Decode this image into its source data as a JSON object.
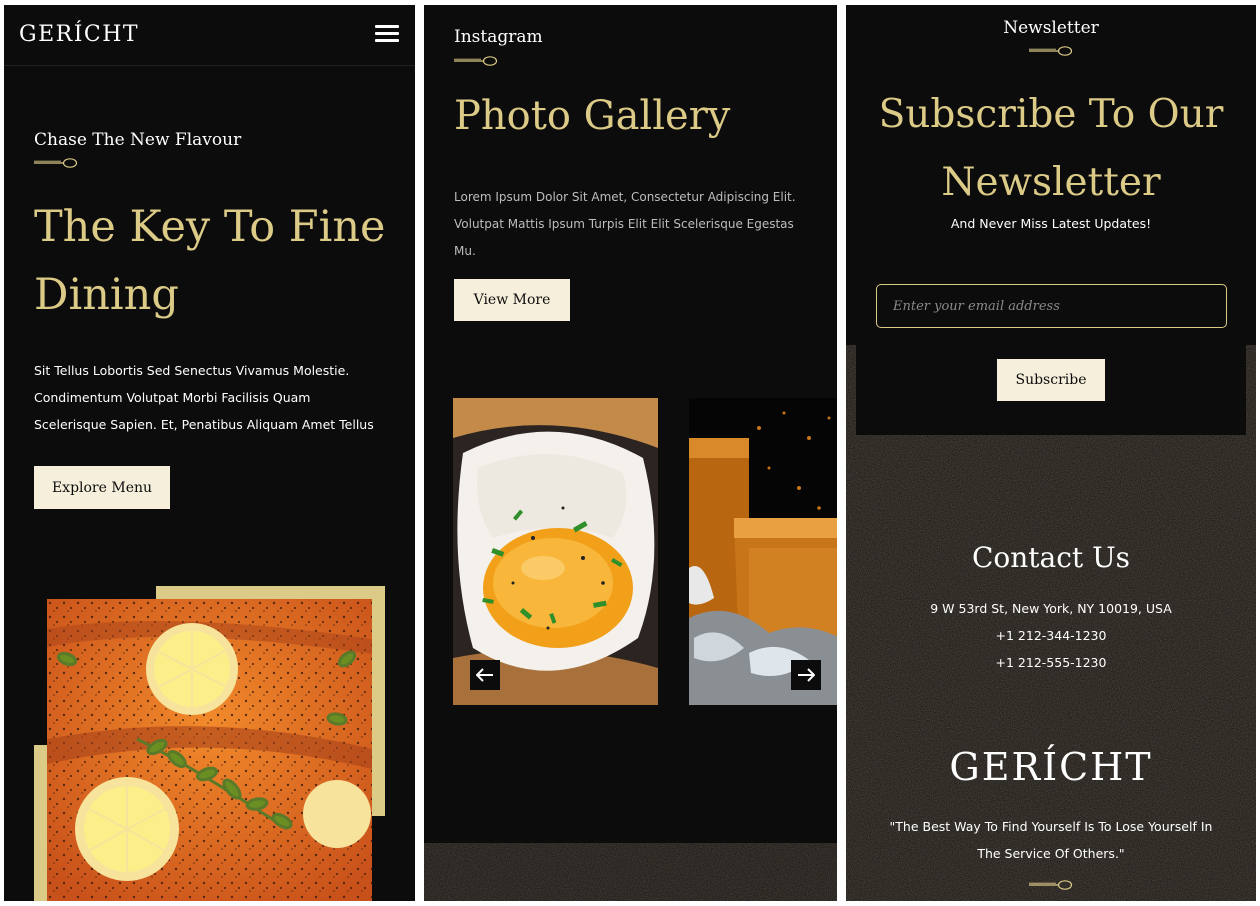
{
  "hero": {
    "logo": "GERÍCHT",
    "subtitle": "Chase The New Flavour",
    "title": "The Key To Fine Dining",
    "description": "Sit Tellus Lobortis Sed Senectus Vivamus Molestie. Condimentum Volutpat Morbi Facilisis Quam Scelerisque Sapien. Et, Penatibus Aliquam Amet Tellus",
    "button": "Explore Menu",
    "image_icon": "salmon-dish-image"
  },
  "gallery": {
    "label": "Instagram",
    "title": "Photo Gallery",
    "description": "Lorem Ipsum Dolor Sit Amet, Consectetur Adipiscing Elit. Volutpat Mattis Ipsum Turpis Elit Elit Scelerisque Egestas Mu.",
    "button": "View More",
    "images": [
      "fried-egg-toast-image",
      "whiskey-glass-image"
    ],
    "arrow_left_icon": "arrow-left-icon",
    "arrow_right_icon": "arrow-right-icon"
  },
  "newsletter": {
    "label": "Newsletter",
    "title": "Subscribe To Our Newsletter",
    "subtitle": "And Never Miss Latest Updates!",
    "placeholder": "Enter your email address",
    "button": "Subscribe"
  },
  "contact": {
    "title": "Contact Us",
    "address": "9 W 53rd St, New York, NY 10019, USA",
    "phone1": "+1 212-344-1230",
    "phone2": "+1 212-555-1230"
  },
  "footer": {
    "logo": "GERÍCHT",
    "quote": "\"The Best Way To Find Yourself Is To Lose Yourself In The Service Of Others.\""
  },
  "colors": {
    "background": "#0c0c0c",
    "gold": "#dcca87",
    "cream": "#f5efdb",
    "white": "#ffffff"
  }
}
